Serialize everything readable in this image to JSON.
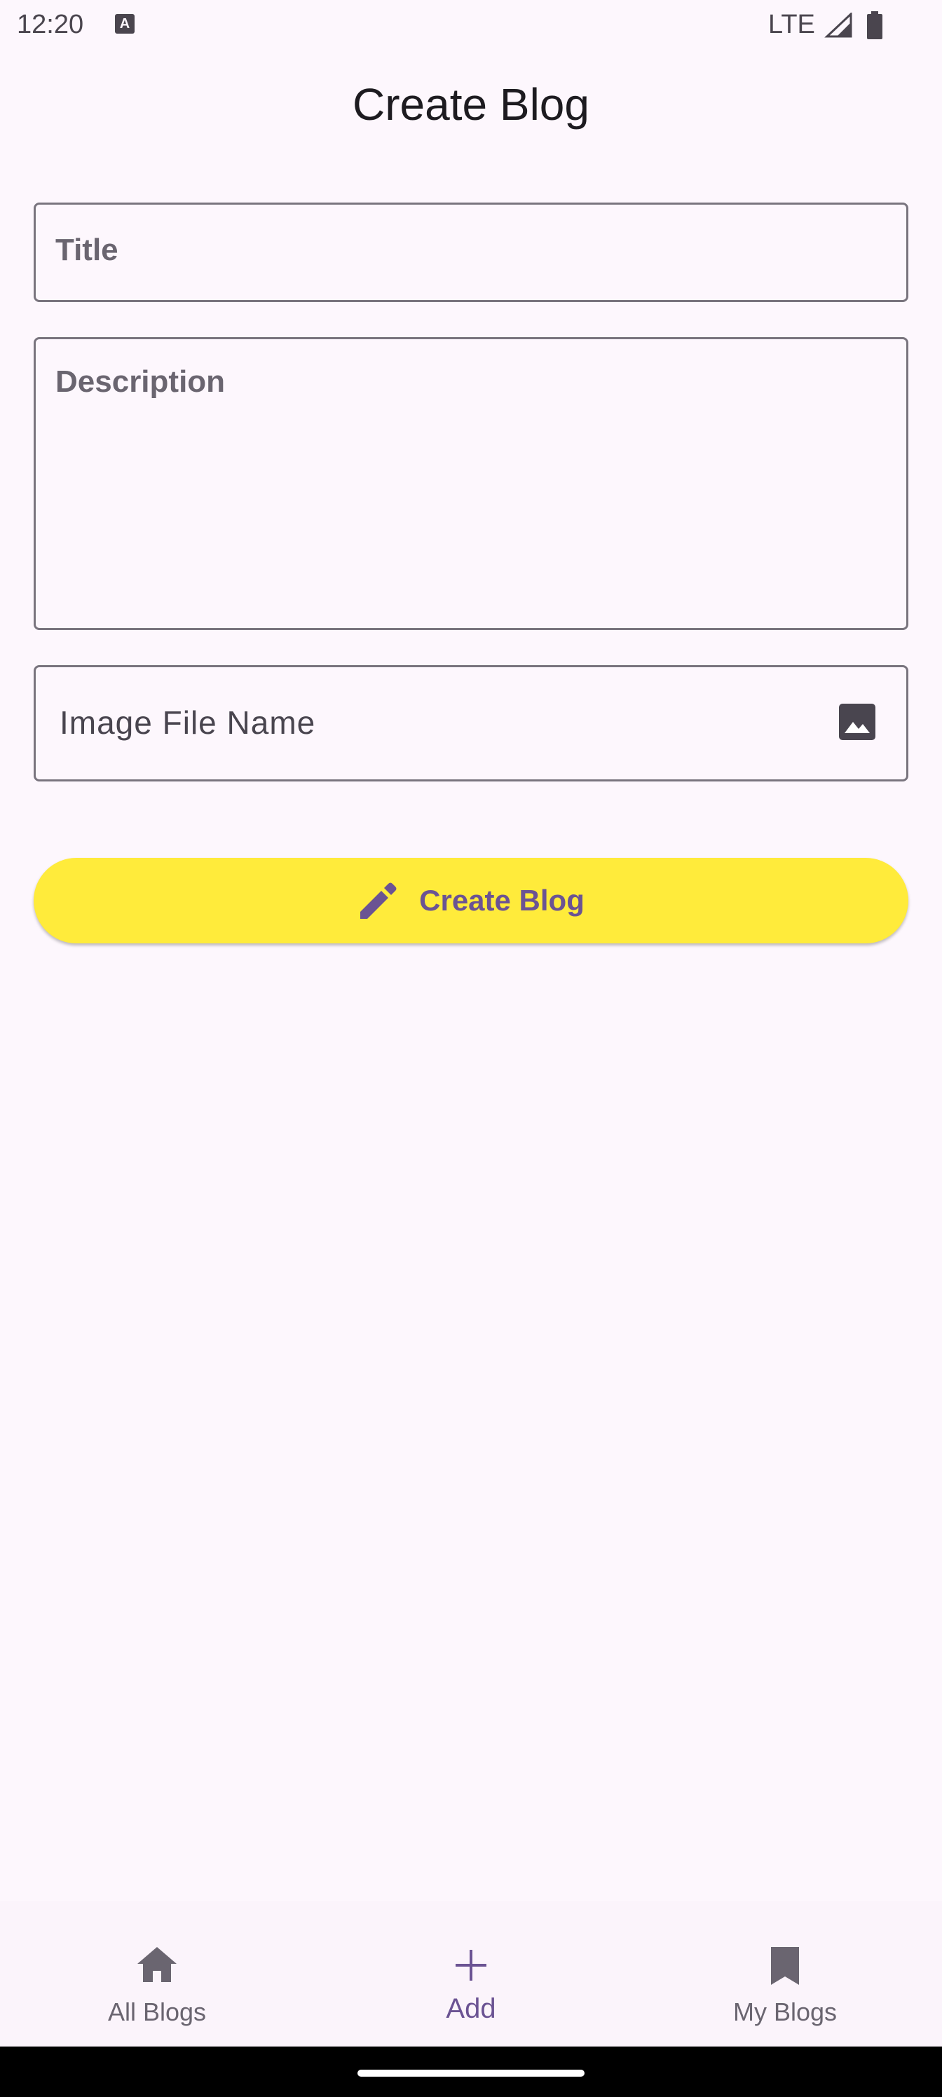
{
  "status_bar": {
    "time": "12:20",
    "app_icon_glyph": "A",
    "network": "LTE"
  },
  "page": {
    "title": "Create Blog"
  },
  "form": {
    "title_placeholder": "Title",
    "description_placeholder": "Description",
    "image_placeholder": "Image File Name"
  },
  "create_button": {
    "label": "Create Blog",
    "icon": "pencil-icon"
  },
  "bottom_nav": {
    "items": [
      {
        "label": "All Blogs",
        "icon": "home-icon"
      },
      {
        "label": "Add",
        "icon": "plus-icon",
        "selected": true
      },
      {
        "label": "My Blogs",
        "icon": "bookmark-icon"
      }
    ]
  },
  "colors": {
    "background": "#fdf7fd",
    "accent": "#6b5393",
    "button": "#ffeb3b",
    "outline": "#79747e"
  }
}
